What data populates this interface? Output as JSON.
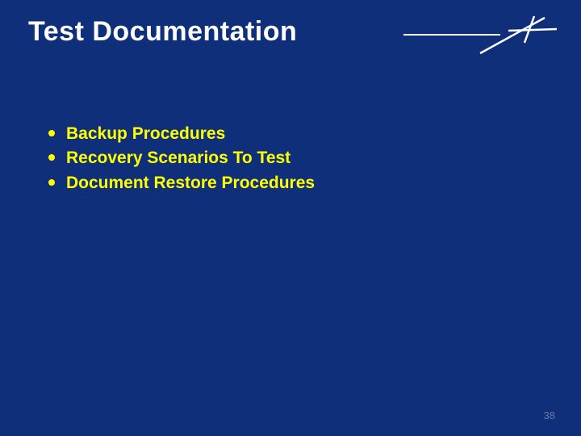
{
  "title": "Test Documentation",
  "bullets": [
    "Backup Procedures",
    "Recovery Scenarios To Test",
    "Document Restore Procedures"
  ],
  "page_number": "38",
  "colors": {
    "background": "#0f2f7a",
    "title": "#ffffff",
    "accent": "#ffff00"
  }
}
